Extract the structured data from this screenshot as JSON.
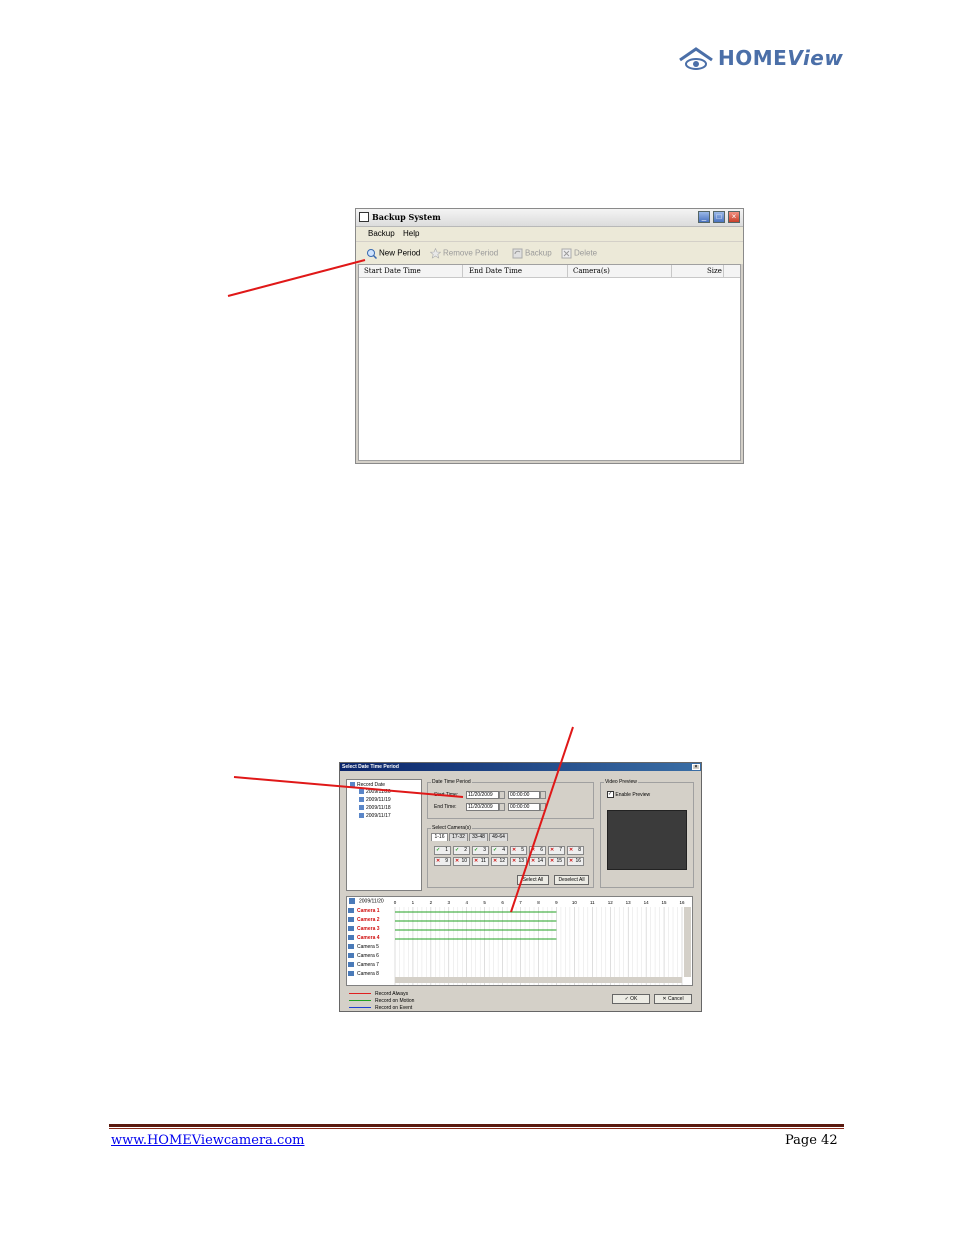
{
  "logo": {
    "brand_main": "HOME",
    "brand_italic": "View"
  },
  "backup_window": {
    "title": "Backup System",
    "menu": [
      "Backup",
      "Help"
    ],
    "toolbar": {
      "new_period": "New Period",
      "remove_period": "Remove Period",
      "backup": "Backup",
      "delete": "Delete"
    },
    "columns": [
      "Start Date Time",
      "End Date Time",
      "Camera(s)",
      "Size"
    ]
  },
  "select_dialog": {
    "title": "Select Date Time Period",
    "tree": {
      "root": "Record Date",
      "dates": [
        "2009/11/20",
        "2009/11/19",
        "2009/11/18",
        "2009/11/17"
      ]
    },
    "date_time_period": {
      "label": "Date Time Period",
      "start_label": "Start Time:",
      "start_date": "11/20/2009",
      "start_time": "00:00:00",
      "end_label": "End Time:",
      "end_date": "11/20/2009",
      "end_time": "00:00:00"
    },
    "select_cameras": {
      "label": "Select Camera(s)",
      "tabs": [
        "1-16",
        "17-32",
        "33-48",
        "49-64"
      ],
      "cameras": [
        {
          "n": "1",
          "on": true
        },
        {
          "n": "2",
          "on": true
        },
        {
          "n": "3",
          "on": true
        },
        {
          "n": "4",
          "on": true
        },
        {
          "n": "5",
          "on": false
        },
        {
          "n": "6",
          "on": false
        },
        {
          "n": "7",
          "on": false
        },
        {
          "n": "8",
          "on": false
        },
        {
          "n": "9",
          "on": false
        },
        {
          "n": "10",
          "on": false
        },
        {
          "n": "11",
          "on": false
        },
        {
          "n": "12",
          "on": false
        },
        {
          "n": "13",
          "on": false
        },
        {
          "n": "14",
          "on": false
        },
        {
          "n": "15",
          "on": false
        },
        {
          "n": "16",
          "on": false
        }
      ],
      "select_all": "Select All",
      "deselect_all": "Deselect All"
    },
    "video_preview": {
      "label": "Video Preview",
      "enable_preview": "Enable Preview"
    },
    "timeline": {
      "date": "2009/11/20",
      "hours": [
        "0",
        "1",
        "2",
        "3",
        "4",
        "5",
        "6",
        "7",
        "8",
        "9",
        "10",
        "11",
        "12",
        "13",
        "14",
        "15",
        "16"
      ],
      "camera_rows": [
        {
          "name": "Camera 1",
          "active": true
        },
        {
          "name": "Camera 2",
          "active": true
        },
        {
          "name": "Camera 3",
          "active": true
        },
        {
          "name": "Camera 4",
          "active": true
        },
        {
          "name": "Camera 5",
          "active": false
        },
        {
          "name": "Camera 6",
          "active": false
        },
        {
          "name": "Camera 7",
          "active": false
        },
        {
          "name": "Camera 8",
          "active": false
        }
      ]
    },
    "legend": [
      {
        "label": "Record Always",
        "color": "#e02020"
      },
      {
        "label": "Record on Motion",
        "color": "#20a020"
      },
      {
        "label": "Record on Event",
        "color": "#2040d0"
      }
    ],
    "ok": "OK",
    "cancel": "Cancel"
  },
  "footer": {
    "website": "www.HOMEViewcamera.com",
    "page": "Page 42"
  }
}
